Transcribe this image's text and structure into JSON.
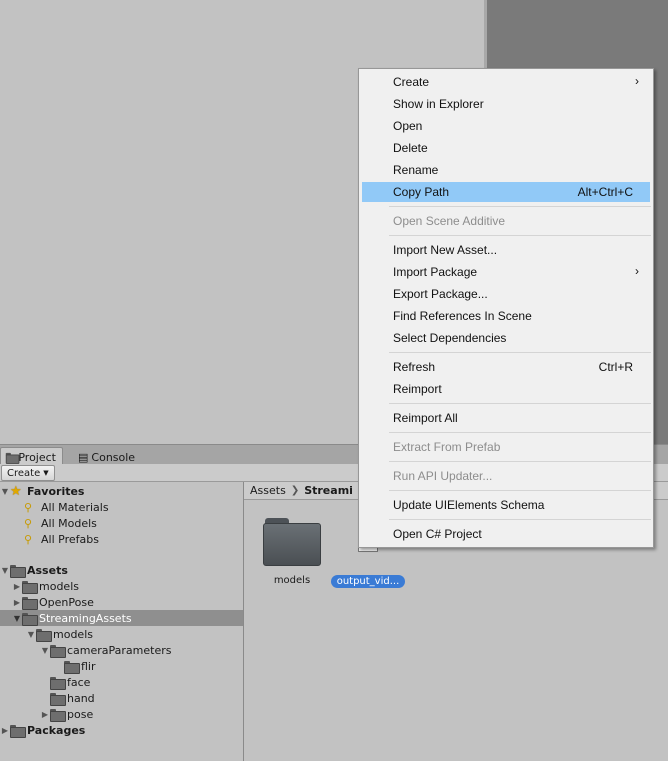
{
  "tabs": {
    "project": "Project",
    "console": "Console"
  },
  "toolbar": {
    "create_label": "Create"
  },
  "tree": {
    "favorites_label": "Favorites",
    "favorites": [
      "All Materials",
      "All Models",
      "All Prefabs"
    ],
    "assets_label": "Assets",
    "models": "models",
    "openpose": "OpenPose",
    "streaming_assets": "StreamingAssets",
    "sa_models": "models",
    "camera_parameters": "cameraParameters",
    "flir": "flir",
    "face": "face",
    "hand": "hand",
    "pose": "pose",
    "packages_label": "Packages"
  },
  "breadcrumb": {
    "root": "Assets",
    "current": "Streami"
  },
  "assets_view": {
    "folder_label": "models",
    "file_label": "output_vid..."
  },
  "context_menu": {
    "create": "Create",
    "show_in_explorer": "Show in Explorer",
    "open": "Open",
    "delete": "Delete",
    "rename": "Rename",
    "copy_path": "Copy Path",
    "copy_path_shortcut": "Alt+Ctrl+C",
    "open_scene_additive": "Open Scene Additive",
    "import_new_asset": "Import New Asset...",
    "import_package": "Import Package",
    "export_package": "Export Package...",
    "find_references": "Find References In Scene",
    "select_dependencies": "Select Dependencies",
    "refresh": "Refresh",
    "refresh_shortcut": "Ctrl+R",
    "reimport": "Reimport",
    "reimport_all": "Reimport All",
    "extract_from_prefab": "Extract From Prefab",
    "run_api_updater": "Run API Updater...",
    "update_uielements": "Update UIElements Schema",
    "open_csharp_project": "Open C# Project"
  },
  "colors": {
    "menu_highlight": "#91c9f7",
    "selection_blue": "#3a7bd5",
    "tree_selected": "#8f8f8f"
  }
}
